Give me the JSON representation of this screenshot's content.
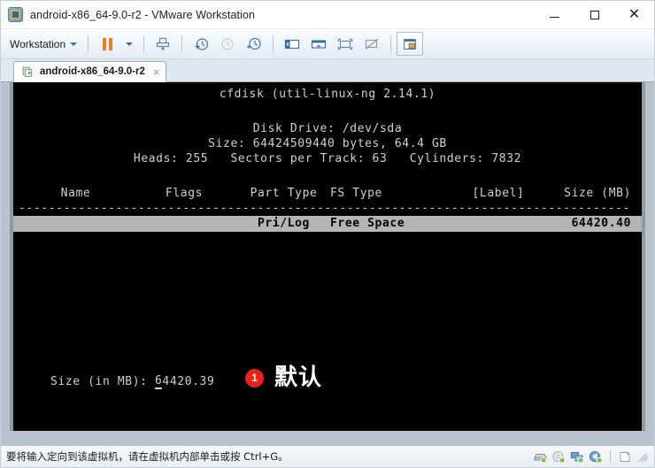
{
  "window": {
    "title": "android-x86_64-9.0-r2 - VMware Workstation",
    "icon": "vmware-vm-icon",
    "controls": {
      "minimize": "minimize-icon",
      "maximize": "maximize-icon",
      "close": "close-icon"
    }
  },
  "toolbar": {
    "menu_label": "Workstation",
    "buttons": [
      {
        "name": "suspend-pause-button",
        "icon": "pause-icon",
        "label": "Suspend"
      },
      {
        "name": "power-dropdown-button",
        "icon": "chevron-down-icon",
        "label": "Power options"
      },
      {
        "name": "send-ctrl-alt-del-button",
        "icon": "keyboard-send-icon",
        "label": "Send Ctrl+Alt+Del"
      },
      {
        "name": "take-snapshot-button",
        "icon": "snapshot-add-icon",
        "label": "Take snapshot"
      },
      {
        "name": "revert-snapshot-button",
        "icon": "snapshot-revert-icon",
        "label": "Revert to snapshot"
      },
      {
        "name": "manage-snapshots-button",
        "icon": "snapshot-manager-icon",
        "label": "Manage snapshots"
      },
      {
        "name": "show-library-button",
        "icon": "library-panel-icon",
        "label": "Show or hide library"
      },
      {
        "name": "show-thumbnails-button",
        "icon": "thumbnail-bar-icon",
        "label": "Show or hide thumbnail bar"
      },
      {
        "name": "enter-fullscreen-button",
        "icon": "fullscreen-icon",
        "label": "Enter full screen"
      },
      {
        "name": "unity-mode-button",
        "icon": "unity-mode-icon",
        "label": "Unity mode"
      },
      {
        "name": "console-view-button",
        "icon": "console-view-icon",
        "label": "Console view"
      }
    ]
  },
  "tabs": [
    {
      "name": "vm-tab",
      "label": "android-x86_64-9.0-r2",
      "icon": "vm-play-icon",
      "close": "×",
      "active": true
    }
  ],
  "vm_screen": {
    "title": "cfdisk (util-linux-ng 2.14.1)",
    "drive_line": "Disk Drive: /dev/sda",
    "size_line": "Size: 64424509440 bytes, 64.4 GB",
    "geometry_line": "Heads: 255   Sectors per Track: 63   Cylinders: 7832",
    "columns": {
      "name": "Name",
      "flags": "Flags",
      "part_type": "Part Type",
      "fs_type": "FS Type",
      "label": "[Label]",
      "size": "Size (MB)"
    },
    "divider": "----------------------------------------------------------------------------------",
    "rows": [
      {
        "name": "",
        "flags": "",
        "part_type": "Pri/Log",
        "fs_type": "Free Space",
        "label": "",
        "size": "64420.40",
        "selected": true
      }
    ],
    "prompt_label": "Size (in MB): ",
    "prompt_cursor_char": "6",
    "prompt_value_rest": "4420.39",
    "annotation": {
      "badge": "1",
      "text": "默认"
    },
    "colors": {
      "background": "#000000",
      "foreground": "#d0d0d0",
      "selection_bg": "#b4b4b4",
      "selection_fg": "#000000",
      "annotation_badge": "#e8211a"
    }
  },
  "status_bar": {
    "message": "要将输入定向到该虚拟机，请在虚拟机内部单击或按 Ctrl+G。",
    "devices": [
      {
        "name": "status-harddisk-icon",
        "label": "Hard Disk"
      },
      {
        "name": "status-cddvd-icon",
        "label": "CD/DVD"
      },
      {
        "name": "status-network-icon",
        "label": "Network Adapter"
      },
      {
        "name": "status-sound-icon",
        "label": "Sound Card"
      },
      {
        "name": "status-printer-icon",
        "label": "Printer"
      }
    ]
  }
}
